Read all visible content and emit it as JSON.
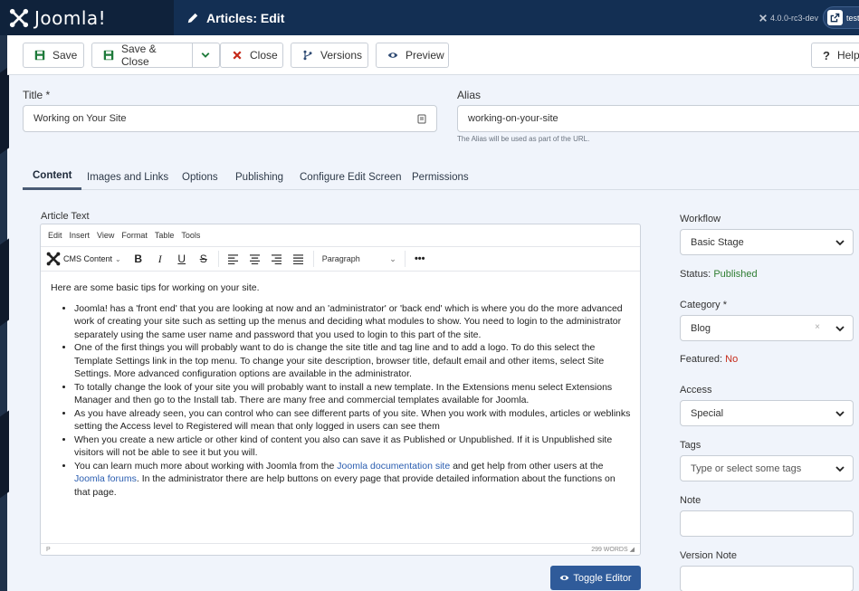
{
  "header": {
    "brand": "Joomla!",
    "page_title": "Articles: Edit",
    "version": "4.0.0-rc3-dev",
    "user_label": "test"
  },
  "toolbar": {
    "save": "Save",
    "save_close": "Save & Close",
    "close": "Close",
    "versions": "Versions",
    "preview": "Preview",
    "help": "Help"
  },
  "form": {
    "title_label": "Title *",
    "title_value": "Working on Your Site",
    "alias_label": "Alias",
    "alias_value": "working-on-your-site",
    "alias_help": "The Alias will be used as part of the URL."
  },
  "tabs": [
    "Content",
    "Images and Links",
    "Options",
    "Publishing",
    "Configure Edit Screen",
    "Permissions"
  ],
  "editor": {
    "label": "Article Text",
    "menu": [
      "Edit",
      "Insert",
      "View",
      "Format",
      "Table",
      "Tools"
    ],
    "cms_content": "CMS Content",
    "paragraph": "Paragraph",
    "path": "P",
    "word_count": "299 WORDS",
    "intro": "Here are some basic tips for working on your site.",
    "bullets": [
      "Joomla! has a 'front end' that you are looking at now and an 'administrator' or 'back end' which is where you do the more advanced work of creating your site such as setting up the menus and deciding what modules to show. You need to login to the administrator separately using the same user name and password that you used to login to this part of the site.",
      "One of the first things you will probably want to do is change the site title and tag line and to add a logo. To do this select the Template Settings link in the top menu. To change your site description, browser title, default email and other items, select Site Settings. More advanced configuration options are available in the administrator.",
      "To totally change the look of your site you will probably want to install a new template. In the Extensions menu select Extensions Manager and then go to the Install tab. There are many free and commercial templates available for Joomla.",
      "As you have already seen, you can control who can see different parts of you site. When you work with modules, articles or weblinks setting the Access level to Registered will mean that only logged in users can see them",
      "When you create a new article or other kind of content you also can save it as Published or Unpublished. If it is Unpublished site visitors will not be able to see it but you will."
    ],
    "last_bullet": {
      "a": "You can learn much more about working with Joomla from the ",
      "link1": "Joomla documentation site",
      "b": " and get help from other users at the ",
      "link2": "Joomla forums",
      "c": ". In the administrator there are help buttons on every page that provide detailed information about the functions on that page."
    },
    "toggle": "Toggle Editor"
  },
  "sidebar": {
    "workflow_label": "Workflow",
    "workflow_value": "Basic Stage",
    "status_label": "Status:",
    "status_value": "Published",
    "category_label": "Category *",
    "category_value": "Blog",
    "featured_label": "Featured:",
    "featured_value": "No",
    "access_label": "Access",
    "access_value": "Special",
    "tags_label": "Tags",
    "tags_placeholder": "Type or select some tags",
    "note_label": "Note",
    "version_note_label": "Version Note"
  },
  "colors": {
    "header": "#132f53",
    "brand_bg": "#0f223b",
    "toggle": "#2f5b9a",
    "published": "#2f7d32",
    "no": "#c52a1a"
  }
}
